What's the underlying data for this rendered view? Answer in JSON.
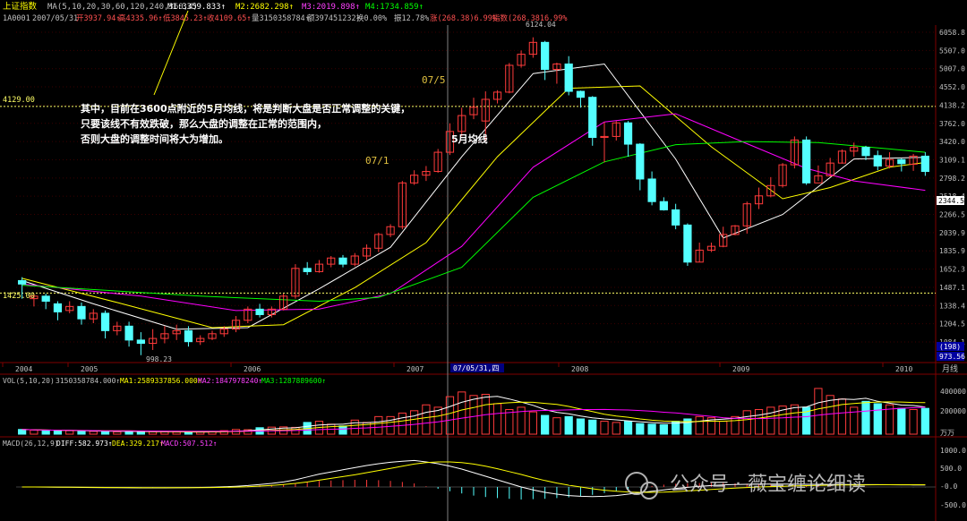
{
  "header": {
    "index_name": "上证指数",
    "ma_params": "MA(5,10,20,30,60,120,240,360,4)",
    "m1": "M1:3359.833↑",
    "m2": "M2:2682.298↑",
    "m3": "M3:2019.898↑",
    "m4": "M4:1734.859↑"
  },
  "info_bar": {
    "code": "1A0001",
    "date": "2007/05/31",
    "open": "开3937.94↑",
    "high": "高4335.96↑",
    "low": "低3845.23↑",
    "close": "收4109.65↑",
    "volume": "量3150358784↑",
    "amount": "额397451232↑",
    "turnover": "换0.00%",
    "amplitude": "振12.78%",
    "change": "涨(268.38)6.99%",
    "index_change": "指数(268.3816.99%"
  },
  "annotations": {
    "commentary": [
      "其中，目前在3600点附近的5月均线，将是判断大盘是否正常调整的关键，",
      "只要该线不有效跌破，那么大盘的调整在正常的范围内，",
      "否则大盘的调整时间将大为增加。"
    ],
    "label_07_5": "07/5",
    "label_07_1": "07/1",
    "label_5ma": "5月均线",
    "high_label": "6124.04",
    "low_label": "998.23",
    "level_4129": "4129.00",
    "level_1425": "1425.00",
    "cursor_date": "07/05/31,四",
    "current_price": "2344.5",
    "price_box_1": "(198)",
    "price_box_2": "973.56"
  },
  "price_axis": [
    "6058.8",
    "5507.0",
    "5007.0",
    "4552.0",
    "4138.2",
    "3762.0",
    "3420.0",
    "3109.1",
    "2798.2",
    "2518.4",
    "2266.5",
    "2039.9",
    "1835.9",
    "1652.3",
    "1487.1",
    "1338.4",
    "1204.5",
    "1084.1"
  ],
  "year_labels": [
    "2004",
    "2005",
    "2006",
    "2007",
    "2008",
    "2009",
    "2010"
  ],
  "year_axis_label": "月线",
  "volume_panel": {
    "title": "VOL(5,10,20)",
    "value": "3150358784.000↑",
    "ma1": "MA1:2589337856.000↑",
    "ma2": "MA2:1847978240↑",
    "ma3": "MA3:1287889600↑",
    "axis": [
      "400000",
      "200000"
    ],
    "unit": "万万"
  },
  "macd_panel": {
    "title": "MACD(26,12,9)",
    "diff": "DIFF:582.973↑",
    "dea": "DEA:329.217↑",
    "macd": "MACD:507.512↑",
    "axis": [
      "1000.0",
      "500.0",
      "-0.0",
      "-500.0"
    ]
  },
  "watermark": "公众号 · 薇宝缠论细读",
  "colors": {
    "up": "#ff3b3b",
    "down": "#54ffff",
    "ma5": "#ffffff",
    "ma10": "#ffff00",
    "ma20": "#ff00ff",
    "ma30": "#00ff00",
    "cursor": "#808080",
    "level_line": "#ffff66"
  },
  "chart_data": {
    "type": "candlestick",
    "x_start": "2004-03",
    "x_end": "2010-10",
    "ylim": [
      973.56,
      6500
    ],
    "y_scale": "log",
    "candles": [
      [
        1530,
        1500,
        1560,
        1380
      ],
      [
        1380,
        1400,
        1420,
        1320
      ],
      [
        1400,
        1360,
        1420,
        1300
      ],
      [
        1340,
        1280,
        1360,
        1220
      ],
      [
        1290,
        1320,
        1360,
        1270
      ],
      [
        1320,
        1230,
        1350,
        1190
      ],
      [
        1230,
        1270,
        1300,
        1200
      ],
      [
        1270,
        1150,
        1290,
        1100
      ],
      [
        1150,
        1180,
        1210,
        1120
      ],
      [
        1180,
        1090,
        1210,
        1050
      ],
      [
        1090,
        1070,
        1140,
        1000
      ],
      [
        1070,
        1100,
        1160,
        1030
      ],
      [
        1100,
        1130,
        1180,
        1070
      ],
      [
        1130,
        1150,
        1190,
        1090
      ],
      [
        1150,
        1080,
        1180,
        1050
      ],
      [
        1080,
        1100,
        1120,
        1060
      ],
      [
        1100,
        1130,
        1150,
        1090
      ],
      [
        1130,
        1160,
        1180,
        1110
      ],
      [
        1160,
        1220,
        1250,
        1140
      ],
      [
        1220,
        1300,
        1320,
        1200
      ],
      [
        1300,
        1260,
        1340,
        1240
      ],
      [
        1260,
        1300,
        1320,
        1240
      ],
      [
        1300,
        1400,
        1420,
        1290
      ],
      [
        1400,
        1640,
        1680,
        1380
      ],
      [
        1640,
        1610,
        1700,
        1580
      ],
      [
        1610,
        1680,
        1720,
        1600
      ],
      [
        1680,
        1740,
        1760,
        1650
      ],
      [
        1740,
        1680,
        1770,
        1650
      ],
      [
        1680,
        1760,
        1790,
        1660
      ],
      [
        1760,
        1840,
        1880,
        1720
      ],
      [
        1840,
        1990,
        2010,
        1800
      ],
      [
        1990,
        2080,
        2110,
        1960
      ],
      [
        2080,
        2670,
        2700,
        2050
      ],
      [
        2670,
        2790,
        2870,
        2640
      ],
      [
        2790,
        2850,
        2940,
        2700
      ],
      [
        2850,
        3180,
        3240,
        2830
      ],
      [
        3180,
        3580,
        3750,
        3130
      ],
      [
        3580,
        3920,
        4100,
        3480
      ],
      [
        3940,
        4110,
        4340,
        3840
      ],
      [
        3800,
        4300,
        4500,
        3400
      ],
      [
        4300,
        4480,
        4530,
        4200
      ],
      [
        4480,
        5220,
        5290,
        4450
      ],
      [
        5220,
        5560,
        5680,
        5150
      ],
      [
        5560,
        5950,
        6124,
        5450
      ],
      [
        5950,
        5100,
        6000,
        4800
      ],
      [
        5100,
        5260,
        5300,
        4700
      ],
      [
        5260,
        4500,
        5500,
        4400
      ],
      [
        4500,
        4350,
        4520,
        4100
      ],
      [
        4350,
        3460,
        4380,
        3300
      ],
      [
        3460,
        3480,
        3780,
        3000
      ],
      [
        3480,
        3760,
        3800,
        3400
      ],
      [
        3760,
        3330,
        3800,
        3100
      ],
      [
        3330,
        2730,
        3350,
        2560
      ],
      [
        2730,
        2400,
        2850,
        2350
      ],
      [
        2400,
        2290,
        2460,
        2280
      ],
      [
        2290,
        2100,
        2370,
        2050
      ],
      [
        2100,
        1700,
        2120,
        1664
      ],
      [
        1700,
        1820,
        1900,
        1700
      ],
      [
        1820,
        1860,
        1900,
        1800
      ],
      [
        1860,
        1990,
        2080,
        1850
      ],
      [
        1990,
        2090,
        2100,
        1980
      ],
      [
        2090,
        2370,
        2400,
        2000
      ],
      [
        2370,
        2480,
        2600,
        2300
      ],
      [
        2480,
        2630,
        2760,
        2460
      ],
      [
        2630,
        2960,
        2990,
        2600
      ],
      [
        2960,
        3410,
        3480,
        2900
      ],
      [
        3410,
        2670,
        3480,
        2640
      ],
      [
        2670,
        2780,
        2950,
        2700
      ],
      [
        2780,
        2990,
        3080,
        2770
      ],
      [
        2990,
        3200,
        3230,
        2980
      ],
      [
        3200,
        3270,
        3360,
        3100
      ],
      [
        3270,
        3120,
        3300,
        3040
      ],
      [
        3120,
        2940,
        3210,
        2870
      ],
      [
        2940,
        3050,
        3180,
        2900
      ],
      [
        3050,
        2980,
        3070,
        2850
      ],
      [
        2970,
        3110,
        3150,
        2860
      ],
      [
        3110,
        2850,
        3180,
        2780
      ]
    ],
    "series": [
      {
        "name": "MA5",
        "color": "#ffffff",
        "points": [
          [
            0,
            1530
          ],
          [
            6,
            1340
          ],
          [
            13,
            1160
          ],
          [
            19,
            1170
          ],
          [
            25,
            1460
          ],
          [
            31,
            1850
          ],
          [
            37,
            3100
          ],
          [
            43,
            4980
          ],
          [
            49,
            5260
          ],
          [
            55,
            3060
          ],
          [
            59,
            1950
          ],
          [
            64,
            2230
          ],
          [
            70,
            3060
          ],
          [
            76,
            3090
          ]
        ]
      },
      {
        "name": "MA10",
        "color": "#ffff00",
        "points": [
          [
            0,
            1550
          ],
          [
            8,
            1350
          ],
          [
            16,
            1170
          ],
          [
            22,
            1190
          ],
          [
            28,
            1470
          ],
          [
            34,
            1900
          ],
          [
            40,
            3100
          ],
          [
            46,
            4580
          ],
          [
            52,
            4640
          ],
          [
            58,
            3280
          ],
          [
            64,
            2440
          ],
          [
            68,
            2600
          ],
          [
            73,
            2920
          ],
          [
            76,
            3000
          ]
        ]
      },
      {
        "name": "MA20",
        "color": "#ff00ff",
        "points": [
          [
            0,
            1500
          ],
          [
            10,
            1400
          ],
          [
            18,
            1290
          ],
          [
            25,
            1300
          ],
          [
            31,
            1420
          ],
          [
            37,
            1860
          ],
          [
            43,
            2920
          ],
          [
            49,
            3780
          ],
          [
            55,
            3960
          ],
          [
            61,
            3340
          ],
          [
            66,
            2900
          ],
          [
            70,
            2700
          ],
          [
            76,
            2560
          ]
        ]
      },
      {
        "name": "MA30",
        "color": "#00ff00",
        "points": [
          [
            0,
            1490
          ],
          [
            15,
            1400
          ],
          [
            25,
            1360
          ],
          [
            30,
            1390
          ],
          [
            37,
            1650
          ],
          [
            43,
            2460
          ],
          [
            49,
            3010
          ],
          [
            55,
            3320
          ],
          [
            61,
            3380
          ],
          [
            67,
            3360
          ],
          [
            73,
            3240
          ],
          [
            76,
            3180
          ]
        ]
      }
    ],
    "volume": [
      40,
      35,
      30,
      28,
      30,
      26,
      24,
      22,
      20,
      25,
      22,
      20,
      20,
      18,
      16,
      18,
      22,
      30,
      40,
      38,
      55,
      60,
      62,
      58,
      100,
      110,
      85,
      70,
      120,
      100,
      150,
      150,
      180,
      200,
      250,
      230,
      320,
      360,
      330,
      340,
      260,
      210,
      230,
      190,
      160,
      140,
      150,
      130,
      120,
      110,
      100,
      110,
      90,
      85,
      80,
      110,
      130,
      150,
      140,
      110,
      150,
      200,
      210,
      230,
      240,
      250,
      230,
      390,
      330,
      300,
      230,
      280,
      260,
      250,
      220,
      210,
      220
    ],
    "macd_diff": [
      0,
      0,
      -2,
      -5,
      -8,
      -12,
      -15,
      -18,
      -20,
      -22,
      -24,
      -25,
      -24,
      -22,
      -18,
      -12,
      -5,
      5,
      20,
      40,
      70,
      100,
      140,
      200,
      280,
      360,
      420,
      480,
      540,
      600,
      650,
      690,
      720,
      740,
      700,
      650,
      580,
      500,
      400,
      300,
      200,
      100,
      0,
      -80,
      -150,
      -200,
      -240,
      -260,
      -270,
      -260,
      -240,
      -200,
      -160,
      -120,
      -80,
      -40,
      -10,
      20,
      40,
      60,
      70,
      75,
      78,
      80,
      80,
      78,
      76,
      74,
      72,
      70,
      68,
      66,
      64,
      62,
      60,
      58,
      58
    ],
    "macd_dea": [
      0,
      0,
      -1,
      -3,
      -5,
      -7,
      -10,
      -12,
      -14,
      -16,
      -18,
      -20,
      -21,
      -21,
      -20,
      -18,
      -15,
      -10,
      -3,
      8,
      24,
      45,
      70,
      100,
      140,
      190,
      240,
      290,
      340,
      400,
      460,
      520,
      580,
      640,
      680,
      700,
      700,
      680,
      640,
      580,
      510,
      430,
      350,
      260,
      180,
      110,
      50,
      0,
      -50,
      -90,
      -120,
      -140,
      -150,
      -150,
      -145,
      -130,
      -110,
      -90,
      -70,
      -50,
      -30,
      -15,
      0,
      10,
      20,
      30,
      38,
      44,
      50,
      54,
      58,
      60,
      62,
      62,
      62,
      62,
      62
    ],
    "macd_hist": [
      0,
      0,
      -1,
      -2,
      -3,
      -5,
      -5,
      -6,
      -6,
      -6,
      -6,
      -5,
      -3,
      -1,
      2,
      6,
      10,
      15,
      23,
      32,
      46,
      55,
      70,
      100,
      140,
      170,
      180,
      190,
      200,
      200,
      190,
      170,
      140,
      100,
      20,
      -50,
      -120,
      -180,
      -240,
      -280,
      -310,
      -330,
      -350,
      -340,
      -330,
      -310,
      -290,
      -260,
      -220,
      -170,
      -120,
      -60,
      -10,
      30,
      65,
      90,
      100,
      110,
      110,
      110,
      100,
      90,
      78,
      70,
      60,
      48,
      38,
      30,
      22,
      16,
      10,
      6,
      2,
      0,
      -2,
      -4,
      -4
    ]
  }
}
